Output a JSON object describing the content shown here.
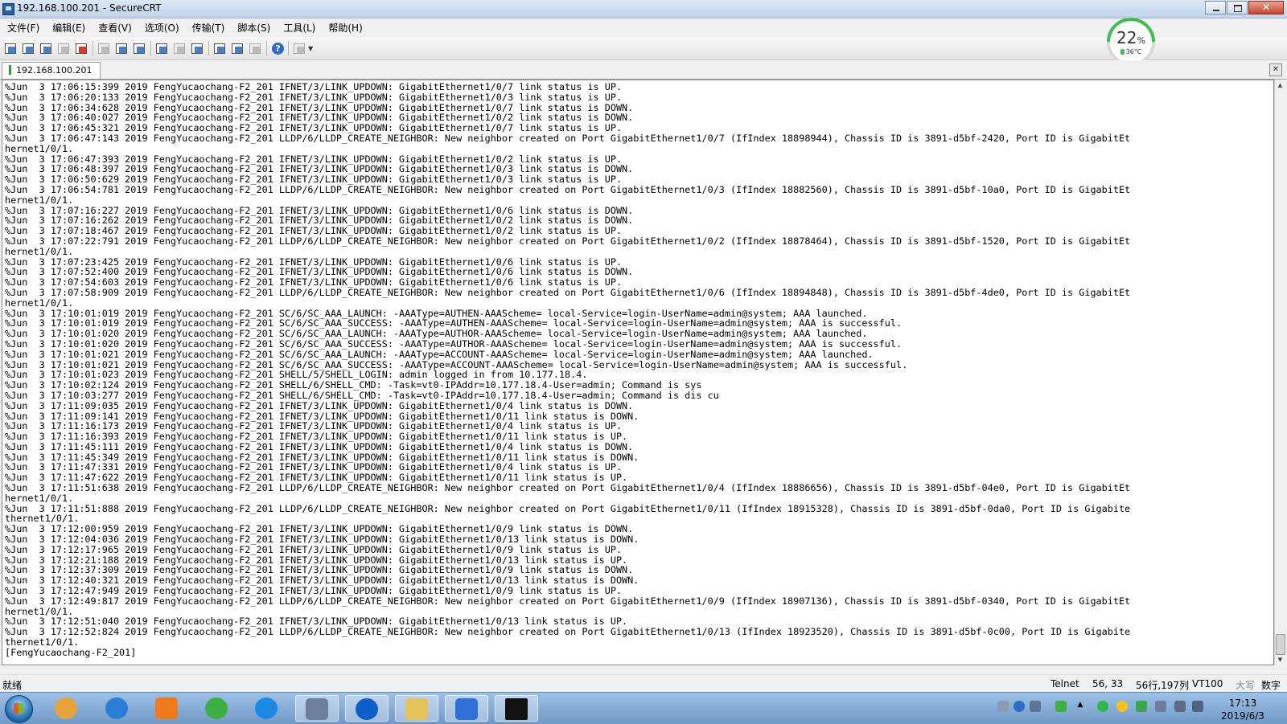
{
  "window": {
    "title": "192.168.100.201 - SecureCRT",
    "min_glyph": "–",
    "max_glyph": "□",
    "close_glyph": "✕"
  },
  "menu": [
    "文件(F)",
    "编辑(E)",
    "查看(V)",
    "选项(O)",
    "传输(T)",
    "脚本(S)",
    "工具(L)",
    "帮助(H)"
  ],
  "toolbar": {
    "icons": [
      "connect-icon",
      "quick-connect-icon",
      "connect-tab-icon",
      "reconnect-icon",
      "disconnect-icon",
      "copy-icon",
      "paste-icon",
      "find-icon",
      "print-icon",
      "print-setup-icon",
      "print-preview-icon",
      "session-options-icon",
      "global-options-icon",
      "keymap-icon",
      "help-icon",
      "sftp-icon"
    ],
    "help_label": "?"
  },
  "cpu_widget": {
    "percent": "22",
    "percent_sign": "%",
    "temperature": "36°C",
    "accent": "#3cbf4c"
  },
  "tab": {
    "label": "192.168.100.201",
    "close_label": "✕"
  },
  "terminal": {
    "lines": [
      "%Jun  3 17:06:15:399 2019 FengYucaochang-F2_201 IFNET/3/LINK_UPDOWN: GigabitEthernet1/0/7 link status is UP.",
      "%Jun  3 17:06:20:133 2019 FengYucaochang-F2_201 IFNET/3/LINK_UPDOWN: GigabitEthernet1/0/3 link status is UP.",
      "%Jun  3 17:06:34:628 2019 FengYucaochang-F2_201 IFNET/3/LINK_UPDOWN: GigabitEthernet1/0/7 link status is DOWN.",
      "%Jun  3 17:06:40:027 2019 FengYucaochang-F2_201 IFNET/3/LINK_UPDOWN: GigabitEthernet1/0/2 link status is DOWN.",
      "%Jun  3 17:06:45:321 2019 FengYucaochang-F2_201 IFNET/3/LINK_UPDOWN: GigabitEthernet1/0/7 link status is UP.",
      "%Jun  3 17:06:47:143 2019 FengYucaochang-F2_201 LLDP/6/LLDP_CREATE_NEIGHBOR: New neighbor created on Port GigabitEthernet1/0/7 (IfIndex 18898944), Chassis ID is 3891-d5bf-2420, Port ID is GigabitEt",
      "hernet1/0/1.",
      "%Jun  3 17:06:47:393 2019 FengYucaochang-F2_201 IFNET/3/LINK_UPDOWN: GigabitEthernet1/0/2 link status is UP.",
      "%Jun  3 17:06:48:397 2019 FengYucaochang-F2_201 IFNET/3/LINK_UPDOWN: GigabitEthernet1/0/3 link status is DOWN.",
      "%Jun  3 17:06:50:629 2019 FengYucaochang-F2_201 IFNET/3/LINK_UPDOWN: GigabitEthernet1/0/3 link status is UP.",
      "%Jun  3 17:06:54:781 2019 FengYucaochang-F2_201 LLDP/6/LLDP_CREATE_NEIGHBOR: New neighbor created on Port GigabitEthernet1/0/3 (IfIndex 18882560), Chassis ID is 3891-d5bf-10a0, Port ID is GigabitEt",
      "hernet1/0/1.",
      "%Jun  3 17:07:16:227 2019 FengYucaochang-F2_201 IFNET/3/LINK_UPDOWN: GigabitEthernet1/0/6 link status is DOWN.",
      "%Jun  3 17:07:16:262 2019 FengYucaochang-F2_201 IFNET/3/LINK_UPDOWN: GigabitEthernet1/0/2 link status is DOWN.",
      "%Jun  3 17:07:18:467 2019 FengYucaochang-F2_201 IFNET/3/LINK_UPDOWN: GigabitEthernet1/0/2 link status is UP.",
      "%Jun  3 17:07:22:791 2019 FengYucaochang-F2_201 LLDP/6/LLDP_CREATE_NEIGHBOR: New neighbor created on Port GigabitEthernet1/0/2 (IfIndex 18878464), Chassis ID is 3891-d5bf-1520, Port ID is GigabitEt",
      "hernet1/0/1.",
      "%Jun  3 17:07:23:425 2019 FengYucaochang-F2_201 IFNET/3/LINK_UPDOWN: GigabitEthernet1/0/6 link status is UP.",
      "%Jun  3 17:07:52:400 2019 FengYucaochang-F2_201 IFNET/3/LINK_UPDOWN: GigabitEthernet1/0/6 link status is DOWN.",
      "%Jun  3 17:07:54:603 2019 FengYucaochang-F2_201 IFNET/3/LINK_UPDOWN: GigabitEthernet1/0/6 link status is UP.",
      "%Jun  3 17:07:58:909 2019 FengYucaochang-F2_201 LLDP/6/LLDP_CREATE_NEIGHBOR: New neighbor created on Port GigabitEthernet1/0/6 (IfIndex 18894848), Chassis ID is 3891-d5bf-4de0, Port ID is GigabitEt",
      "hernet1/0/1.",
      "%Jun  3 17:10:01:019 2019 FengYucaochang-F2_201 SC/6/SC_AAA_LAUNCH: -AAAType=AUTHEN-AAAScheme= local-Service=login-UserName=admin@system; AAA launched.",
      "%Jun  3 17:10:01:019 2019 FengYucaochang-F2_201 SC/6/SC_AAA_SUCCESS: -AAAType=AUTHEN-AAAScheme= local-Service=login-UserName=admin@system; AAA is successful.",
      "%Jun  3 17:10:01:020 2019 FengYucaochang-F2_201 SC/6/SC_AAA_LAUNCH: -AAAType=AUTHOR-AAAScheme= local-Service=login-UserName=admin@system; AAA launched.",
      "%Jun  3 17:10:01:020 2019 FengYucaochang-F2_201 SC/6/SC_AAA_SUCCESS: -AAAType=AUTHOR-AAAScheme= local-Service=login-UserName=admin@system; AAA is successful.",
      "%Jun  3 17:10:01:021 2019 FengYucaochang-F2_201 SC/6/SC_AAA_LAUNCH: -AAAType=ACCOUNT-AAAScheme= local-Service=login-UserName=admin@system; AAA launched.",
      "%Jun  3 17:10:01:021 2019 FengYucaochang-F2_201 SC/6/SC_AAA_SUCCESS: -AAAType=ACCOUNT-AAAScheme= local-Service=login-UserName=admin@system; AAA is successful.",
      "%Jun  3 17:10:01:023 2019 FengYucaochang-F2_201 SHELL/5/SHELL_LOGIN: admin logged in from 10.177.18.4.",
      "%Jun  3 17:10:02:124 2019 FengYucaochang-F2_201 SHELL/6/SHELL_CMD: -Task=vt0-IPAddr=10.177.18.4-User=admin; Command is sys",
      "%Jun  3 17:10:03:277 2019 FengYucaochang-F2_201 SHELL/6/SHELL_CMD: -Task=vt0-IPAddr=10.177.18.4-User=admin; Command is dis cu",
      "%Jun  3 17:11:09:035 2019 FengYucaochang-F2_201 IFNET/3/LINK_UPDOWN: GigabitEthernet1/0/4 link status is DOWN.",
      "%Jun  3 17:11:09:141 2019 FengYucaochang-F2_201 IFNET/3/LINK_UPDOWN: GigabitEthernet1/0/11 link status is DOWN.",
      "%Jun  3 17:11:16:173 2019 FengYucaochang-F2_201 IFNET/3/LINK_UPDOWN: GigabitEthernet1/0/4 link status is UP.",
      "%Jun  3 17:11:16:393 2019 FengYucaochang-F2_201 IFNET/3/LINK_UPDOWN: GigabitEthernet1/0/11 link status is UP.",
      "%Jun  3 17:11:45:111 2019 FengYucaochang-F2_201 IFNET/3/LINK_UPDOWN: GigabitEthernet1/0/4 link status is DOWN.",
      "%Jun  3 17:11:45:349 2019 FengYucaochang-F2_201 IFNET/3/LINK_UPDOWN: GigabitEthernet1/0/11 link status is DOWN.",
      "%Jun  3 17:11:47:331 2019 FengYucaochang-F2_201 IFNET/3/LINK_UPDOWN: GigabitEthernet1/0/4 link status is UP.",
      "%Jun  3 17:11:47:622 2019 FengYucaochang-F2_201 IFNET/3/LINK_UPDOWN: GigabitEthernet1/0/11 link status is UP.",
      "%Jun  3 17:11:51:638 2019 FengYucaochang-F2_201 LLDP/6/LLDP_CREATE_NEIGHBOR: New neighbor created on Port GigabitEthernet1/0/4 (IfIndex 18886656), Chassis ID is 3891-d5bf-04e0, Port ID is GigabitEt",
      "hernet1/0/1.",
      "%Jun  3 17:11:51:888 2019 FengYucaochang-F2_201 LLDP/6/LLDP_CREATE_NEIGHBOR: New neighbor created on Port GigabitEthernet1/0/11 (IfIndex 18915328), Chassis ID is 3891-d5bf-0da0, Port ID is Gigabite",
      "thernet1/0/1.",
      "%Jun  3 17:12:00:959 2019 FengYucaochang-F2_201 IFNET/3/LINK_UPDOWN: GigabitEthernet1/0/9 link status is DOWN.",
      "%Jun  3 17:12:04:036 2019 FengYucaochang-F2_201 IFNET/3/LINK_UPDOWN: GigabitEthernet1/0/13 link status is DOWN.",
      "%Jun  3 17:12:17:965 2019 FengYucaochang-F2_201 IFNET/3/LINK_UPDOWN: GigabitEthernet1/0/9 link status is UP.",
      "%Jun  3 17:12:21:188 2019 FengYucaochang-F2_201 IFNET/3/LINK_UPDOWN: GigabitEthernet1/0/13 link status is UP.",
      "%Jun  3 17:12:37:309 2019 FengYucaochang-F2_201 IFNET/3/LINK_UPDOWN: GigabitEthernet1/0/9 link status is DOWN.",
      "%Jun  3 17:12:40:321 2019 FengYucaochang-F2_201 IFNET/3/LINK_UPDOWN: GigabitEthernet1/0/13 link status is DOWN.",
      "%Jun  3 17:12:47:949 2019 FengYucaochang-F2_201 IFNET/3/LINK_UPDOWN: GigabitEthernet1/0/9 link status is UP.",
      "%Jun  3 17:12:49:817 2019 FengYucaochang-F2_201 LLDP/6/LLDP_CREATE_NEIGHBOR: New neighbor created on Port GigabitEthernet1/0/9 (IfIndex 18907136), Chassis ID is 3891-d5bf-0340, Port ID is GigabitEt",
      "hernet1/0/1.",
      "%Jun  3 17:12:51:040 2019 FengYucaochang-F2_201 IFNET/3/LINK_UPDOWN: GigabitEthernet1/0/13 link status is UP.",
      "%Jun  3 17:12:52:824 2019 FengYucaochang-F2_201 LLDP/6/LLDP_CREATE_NEIGHBOR: New neighbor created on Port GigabitEthernet1/0/13 (IfIndex 18923520), Chassis ID is 3891-d5bf-0c00, Port ID is Gigabite",
      "thernet1/0/1.",
      "[FengYucaochang-F2_201]"
    ]
  },
  "scrollbar": {
    "up": "▲",
    "down": "▼"
  },
  "statusbar": {
    "ready": "就绪",
    "protocol": "Telnet",
    "cursor": "56, 33",
    "size": "56行,197列",
    "emulation": "VT100",
    "caps": "大写",
    "num": "数字"
  },
  "taskbar": {
    "apps": [
      {
        "name": "start-button"
      },
      {
        "name": "taskbar-color-app-icon",
        "color": "#e8a23a"
      },
      {
        "name": "taskbar-ie-icon",
        "color": "#2a7fd4"
      },
      {
        "name": "taskbar-media-player-icon",
        "color": "#f07a1c"
      },
      {
        "name": "taskbar-360-browser-icon",
        "color": "#3cb043"
      },
      {
        "name": "taskbar-cloud-icon",
        "color": "#1e88e5"
      },
      {
        "name": "taskbar-cashier-icon",
        "color": "#6e7f99"
      },
      {
        "name": "taskbar-teamviewer-icon",
        "color": "#0d5ec9"
      },
      {
        "name": "taskbar-folder-icon",
        "color": "#e3c35a"
      },
      {
        "name": "taskbar-wps-icon",
        "color": "#2f6fd6"
      },
      {
        "name": "taskbar-terminal-icon",
        "color": "#111111"
      }
    ],
    "tray_icons": [
      "keyboard-icon",
      "help-icon",
      "network-icon",
      "battery-icon",
      "chevron-up-icon",
      "360-safe-icon",
      "add-icon",
      "shield-icon",
      "sound-mixer-icon",
      "monitor-icon",
      "volume-icon"
    ],
    "time": "17:13",
    "date": "2019/6/3"
  }
}
